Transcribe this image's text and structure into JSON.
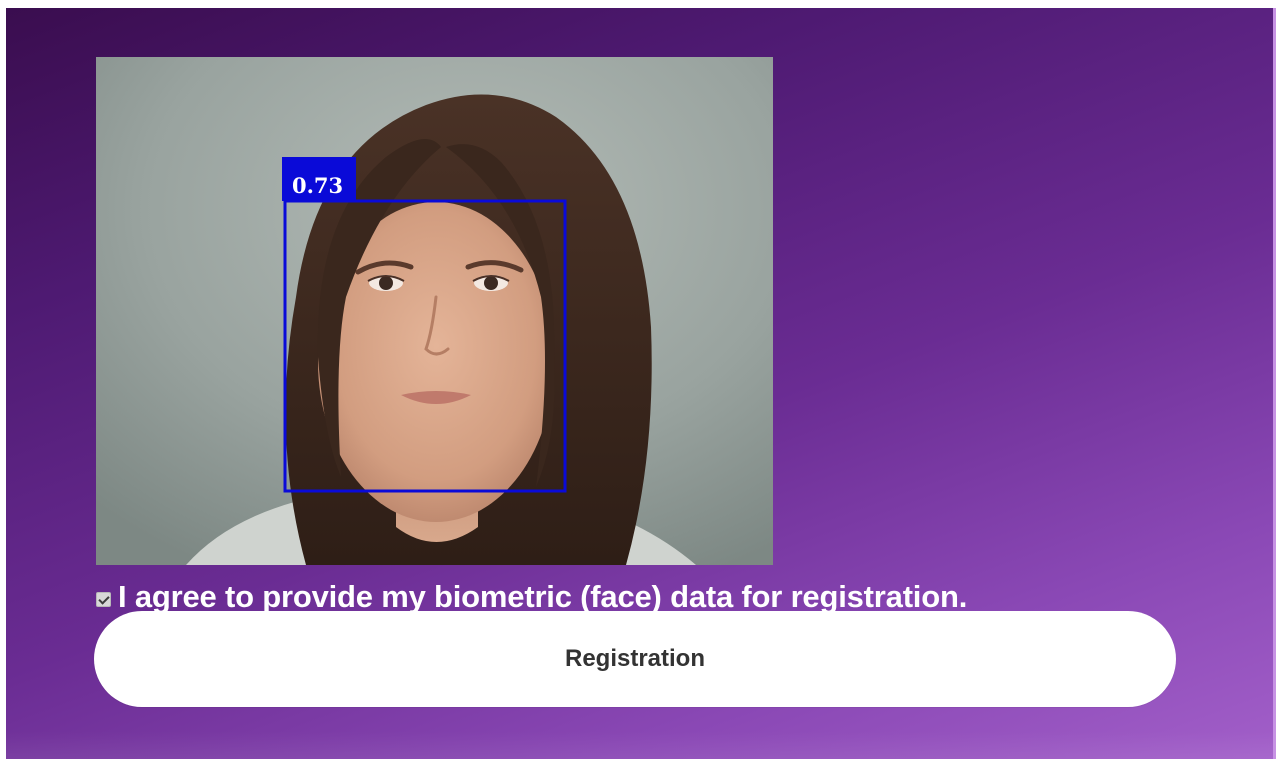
{
  "detection": {
    "confidence_label": "0.73",
    "box_color": "#0a0ad8"
  },
  "consent": {
    "checked": true,
    "label": "I agree to provide my biometric (face) data for registration."
  },
  "actions": {
    "register_label": "Registration"
  },
  "theme": {
    "panel_gradient_start": "#3a0d4f",
    "panel_gradient_end": "#a25fc9",
    "button_bg": "#ffffff",
    "button_text": "#333333"
  }
}
